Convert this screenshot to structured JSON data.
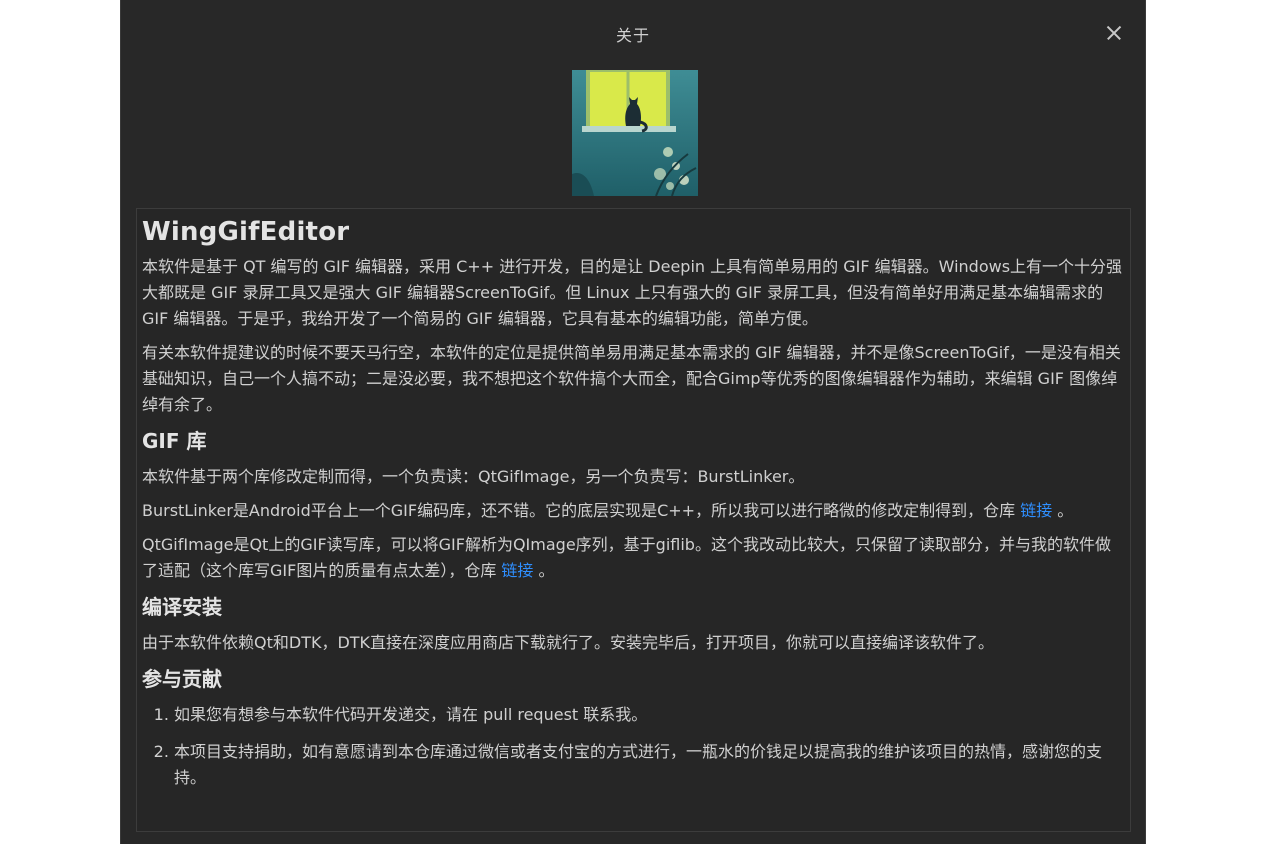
{
  "dialog": {
    "title": "关于",
    "logo_alt": "cat-in-window logo"
  },
  "readme": {
    "app_name": "WingGifEditor",
    "intro_1": "本软件是基于 QT 编写的 GIF 编辑器，采用 C++ 进行开发，目的是让 Deepin 上具有简单易用的 GIF 编辑器。Windows上有一个十分强大都既是 GIF 录屏工具又是强大 GIF 编辑器ScreenToGif。但 Linux 上只有强大的 GIF 录屏工具，但没有简单好用满足基本编辑需求的 GIF 编辑器。于是乎，我给开发了一个简易的 GIF 编辑器，它具有基本的编辑功能，简单方便。",
    "intro_2": "有关本软件提建议的时候不要天马行空，本软件的定位是提供简单易用满足基本需求的 GIF 编辑器，并不是像ScreenToGif，一是没有相关基础知识，自己一个人搞不动；二是没必要，我不想把这个软件搞个大而全，配合Gimp等优秀的图像编辑器作为辅助，来编辑 GIF 图像绰绰有余了。",
    "lib_heading": "GIF 库",
    "lib_p1": "本软件基于两个库修改定制而得，一个负责读：QtGifImage，另一个负责写：BurstLinker。",
    "lib_p2_text": "BurstLinker是Android平台上一个GIF编码库，还不错。它的底层实现是C++，所以我可以进行略微的修改定制得到，仓库 ",
    "lib_p2_link": "链接",
    "lib_p2_end": " 。",
    "lib_p3_text": "QtGifImage是Qt上的GIF读写库，可以将GIF解析为QImage序列，基于giflib。这个我改动比较大，只保留了读取部分，并与我的软件做了适配（这个库写GIF图片的质量有点太差），仓库 ",
    "lib_p3_link": "链接",
    "lib_p3_end": " 。",
    "build_heading": "编译安装",
    "build_p": "由于本软件依赖Qt和DTK，DTK直接在深度应用商店下载就行了。安装完毕后，打开项目，你就可以直接编译该软件了。",
    "contrib_heading": "参与贡献",
    "contrib_items": [
      "如果您有想参与本软件代码开发递交，请在 pull request 联系我。",
      "本项目支持捐助，如有意愿请到本仓库通过微信或者支付宝的方式进行，一瓶水的价钱足以提高我的维护该项目的热情，感谢您的支持。"
    ]
  },
  "colors": {
    "background": "#282828",
    "text": "#d0d0d0",
    "link": "#2f8fff"
  }
}
